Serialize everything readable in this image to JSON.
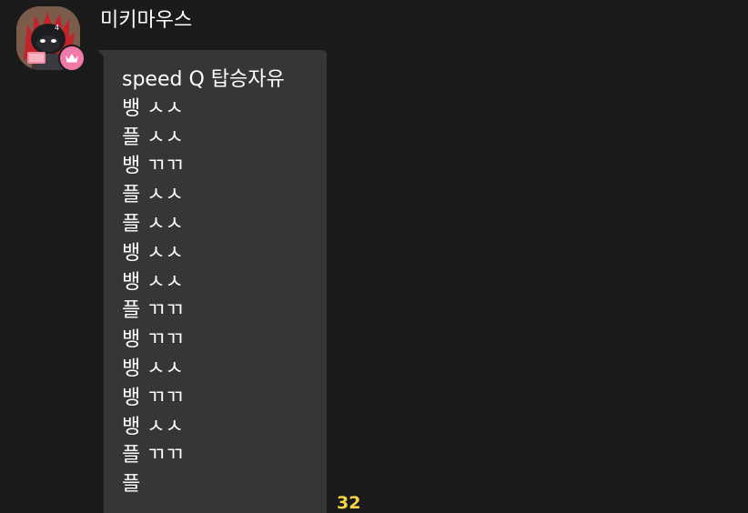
{
  "chat": {
    "sender_name": "미키마우스",
    "avatar_icon": "character-avatar-icon",
    "badge_icon": "crown-icon",
    "badge_color": "#f07aa8",
    "message": {
      "lines": [
        "speed Q 탑승자유",
        "뱅 ㅅㅅ",
        "플 ㅅㅅ",
        "뱅 ㄲㄲ",
        "플 ㅅㅅ",
        "플 ㅅㅅ",
        "뱅 ㅅㅅ",
        "뱅 ㅅㅅ",
        "플 ㄲㄲ",
        "뱅 ㄲㄲ",
        "뱅 ㅅㅅ",
        "뱅 ㄲㄲ",
        "뱅 ㅅㅅ",
        "플 ㄲㄲ",
        "플"
      ]
    },
    "unread_count": "32",
    "unread_color": "#f5d547",
    "bubble_color": "#363636",
    "background_color": "#1b1b1b"
  }
}
